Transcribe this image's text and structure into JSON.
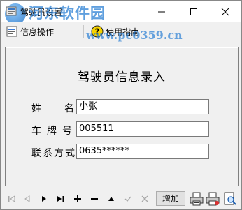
{
  "window": {
    "title": "驾驶员设置",
    "watermark": "河东软件园",
    "watermark_url": "www.pc0359.cn"
  },
  "menu": {
    "items": [
      {
        "label": "信息操作",
        "icon": "info-list-icon"
      },
      {
        "label": "使用指南",
        "icon": "help-icon"
      }
    ]
  },
  "form": {
    "title": "驾驶员信息录入",
    "fields": {
      "name": {
        "label_a": "姓",
        "label_b": "名",
        "value": "小张"
      },
      "plate": {
        "label": "车牌号",
        "value": "005511"
      },
      "contact": {
        "label": "联系方式",
        "value": "0635******"
      }
    }
  },
  "navigator": {
    "buttons": [
      {
        "glyph": "|◀",
        "name": "first-record-button",
        "enabled": false
      },
      {
        "glyph": "◀",
        "name": "prior-record-button",
        "enabled": false
      },
      {
        "glyph": "▶",
        "name": "next-record-button",
        "enabled": true
      },
      {
        "glyph": "▶|",
        "name": "last-record-button",
        "enabled": true
      },
      {
        "glyph": "+",
        "name": "insert-record-button",
        "enabled": true
      },
      {
        "glyph": "—",
        "name": "delete-record-button",
        "enabled": true
      },
      {
        "glyph": "▲",
        "name": "edit-record-button",
        "enabled": true
      },
      {
        "glyph": "✓",
        "name": "post-record-button",
        "enabled": false
      },
      {
        "glyph": "✕",
        "name": "cancel-record-button",
        "enabled": false
      }
    ],
    "add_label": "增加"
  }
}
